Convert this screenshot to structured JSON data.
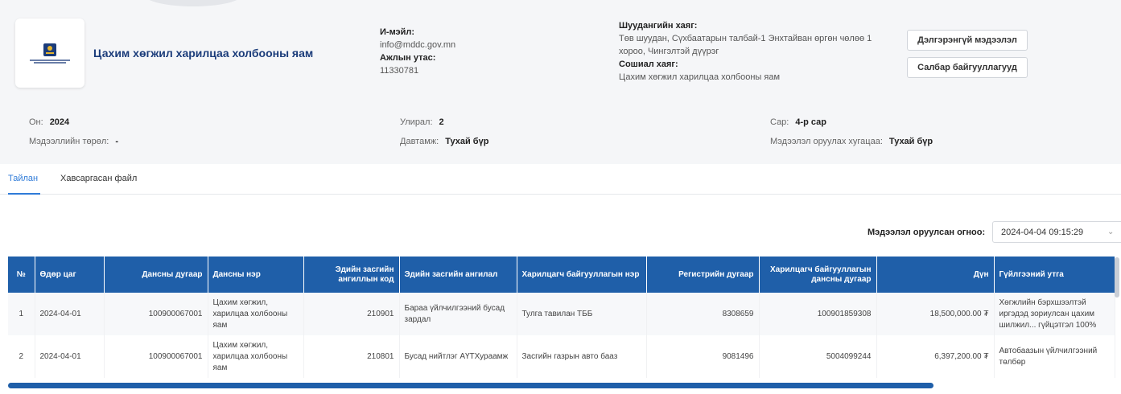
{
  "org": {
    "name": "Цахим хөгжил харилцаа холбооны яам",
    "email_label": "И-мэйл:",
    "email": "info@mddc.gov.mn",
    "phone_label": "Ажлын утас:",
    "phone": "11330781",
    "address_label": "Шуудангийн хаяг:",
    "address": "Төв шуудан, Сүхбаатарын талбай-1 Энхтайван өргөн чөлөө 1 хороо, Чингэлтэй дүүрэг",
    "social_label": "Сошиал хаяг:",
    "social": "Цахим хөгжил харилцаа холбооны яам",
    "detail_button": "Дэлгэрэнгүй мэдээлэл",
    "branch_button": "Салбар байгууллагууд"
  },
  "meta": {
    "year_label": "Он:",
    "year": "2024",
    "type_label": "Мэдээллийн төрөл:",
    "type": "-",
    "quarter_label": "Улирал:",
    "quarter": "2",
    "freq_label": "Давтамж:",
    "freq": "Тухай бүр",
    "month_label": "Сар:",
    "month": "4-р сар",
    "deadline_label": "Мэдээлэл оруулах хугацаа:",
    "deadline": "Тухай бүр"
  },
  "tabs": [
    "Тайлан",
    "Хавсаргасан файл"
  ],
  "entry_date": {
    "label": "Мэдээлэл оруулсан огноо:",
    "value": "2024-04-04 09:15:29"
  },
  "table": {
    "headers": [
      "№",
      "Өдөр цаг",
      "Дансны дугаар",
      "Дансны нэр",
      "Эдийн засгийн ангиллын код",
      "Эдийн засгийн ангилал",
      "Харилцагч байгууллагын нэр",
      "Регистрийн дугаар",
      "Харилцагч байгууллагын дансны дугаар",
      "Дүн",
      "Гүйлгээний утга"
    ],
    "rows": [
      [
        "1",
        "2024-04-01",
        "100900067001",
        "Цахим хөгжил, харилцаа холбооны яам",
        "210901",
        "Бараа үйлчилгээний бусад зардал",
        "Тулга тавилан ТББ",
        "8308659",
        "100901859308",
        "18,500,000.00 ₮",
        "Хөгжлийн бэрхшээлтэй иргэдэд зориулсан цахим шилжил... гүйцэтгэл 100%"
      ],
      [
        "2",
        "2024-04-01",
        "100900067001",
        "Цахим хөгжил, харилцаа холбооны яам",
        "210801",
        "Бусад нийтлэг АҮТХураамж",
        "Засгийн газрын авто бааз",
        "9081496",
        "5004099244",
        "6,397,200.00 ₮",
        "Автобаазын үйлчилгээний төлбөр"
      ]
    ]
  },
  "icons": {
    "chevron": "chevron-down-icon",
    "logo": "ministry-emblem-icon"
  },
  "colors": {
    "primary": "#1f5fa9",
    "accent": "#2f7bd8",
    "org_name": "#1b3c7a"
  }
}
